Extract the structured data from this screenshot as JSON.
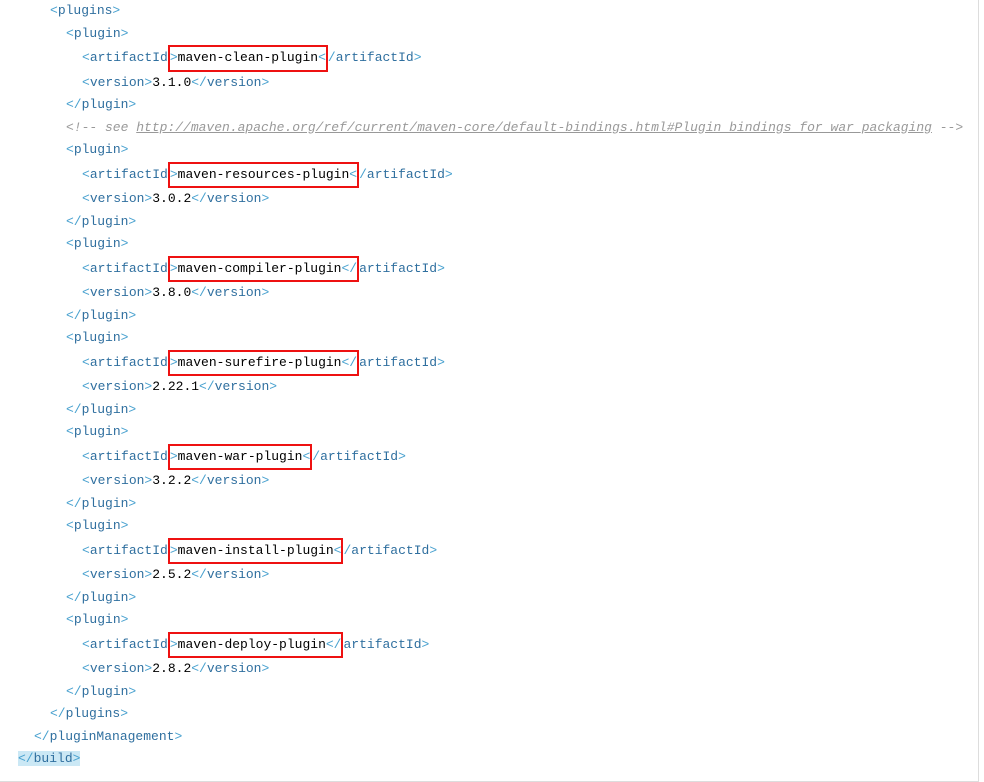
{
  "plugins_open": "plugins",
  "plugins_close": "plugins",
  "plugin": "plugin",
  "artifactId": "artifactId",
  "version": "version",
  "pluginManagement": "pluginManagement",
  "build": "build",
  "comment_prefix": "<!-- see ",
  "comment_link": "http://maven.apache.org/ref/current/maven-core/default-bindings.html#Plugin_bindings_for_war_packaging",
  "comment_suffix": " -->",
  "items": [
    {
      "name": "maven-clean-plugin",
      "ver": "3.1.0"
    },
    {
      "name": "maven-resources-plugin",
      "ver": "3.0.2"
    },
    {
      "name": "maven-compiler-plugin",
      "ver": "3.8.0"
    },
    {
      "name": "maven-surefire-plugin",
      "ver": "2.22.1"
    },
    {
      "name": "maven-war-plugin",
      "ver": "3.2.2"
    },
    {
      "name": "maven-install-plugin",
      "ver": "2.5.2"
    },
    {
      "name": "maven-deploy-plugin",
      "ver": "2.8.2"
    }
  ]
}
